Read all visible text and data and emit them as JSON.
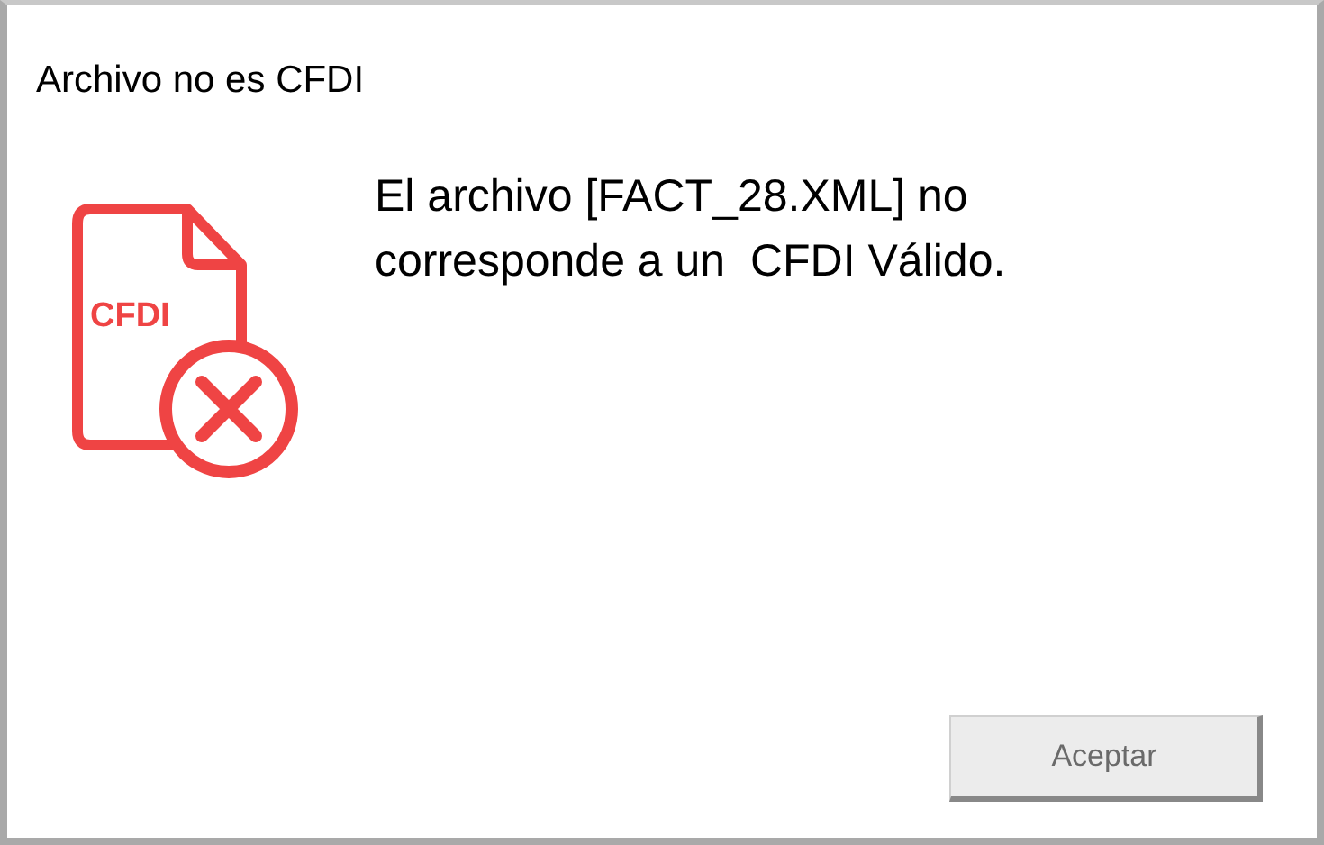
{
  "window": {
    "title": "Archivo no es CFDI"
  },
  "icon_label": "CFDI",
  "message": "El archivo [FACT_28.XML] no corresponde a un  CFDI Válido.",
  "buttons": [
    {
      "label": "Aceptar"
    }
  ]
}
